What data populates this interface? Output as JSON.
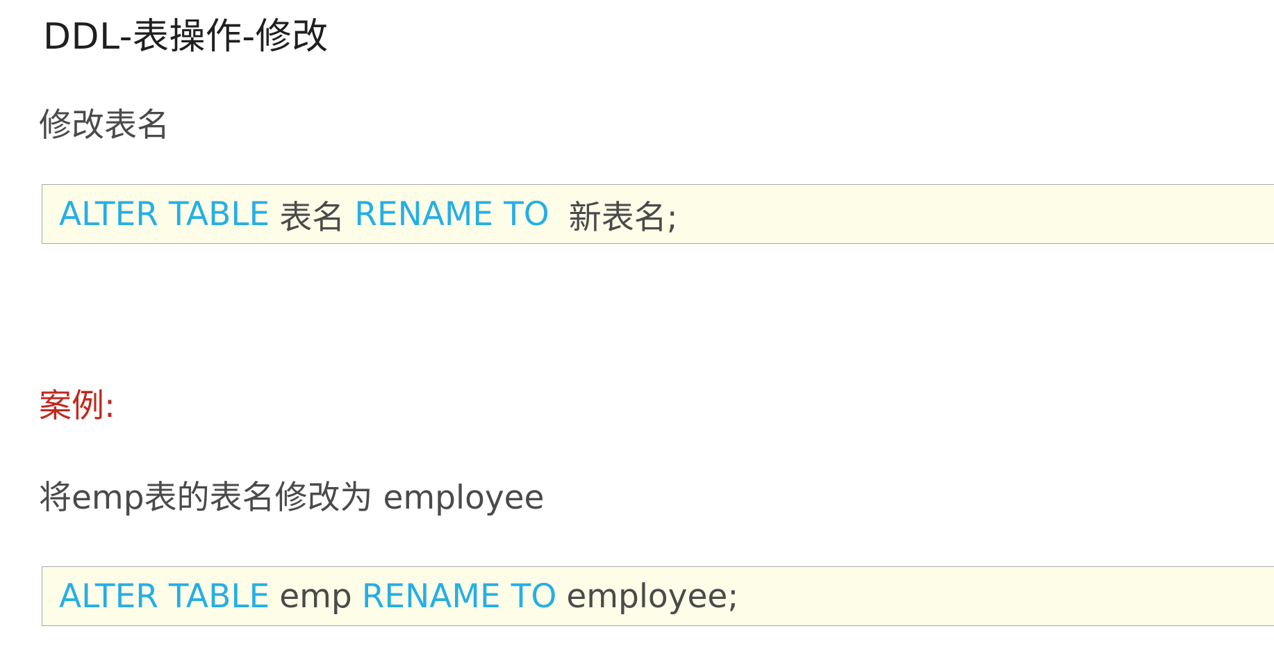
{
  "page": {
    "title": "DDL-表操作-修改"
  },
  "rename_section": {
    "heading": "修改表名",
    "syntax": {
      "kw_alter_table": "ALTER TABLE",
      "table_name": "表名",
      "kw_rename_to": "RENAME TO",
      "new_table_name": "新表名;"
    }
  },
  "example": {
    "heading": "案例:",
    "description": "将emp表的表名修改为 employee",
    "code": {
      "kw_alter_table": "ALTER TABLE",
      "table_name": "emp",
      "kw_rename_to": "RENAME TO",
      "new_table_name": "employee;"
    }
  },
  "colors": {
    "keyword": "#26aee6",
    "text": "#4a4a4a",
    "example_heading": "#c0291d",
    "code_background": "#fefde8",
    "code_border": "#a9a9a3"
  }
}
